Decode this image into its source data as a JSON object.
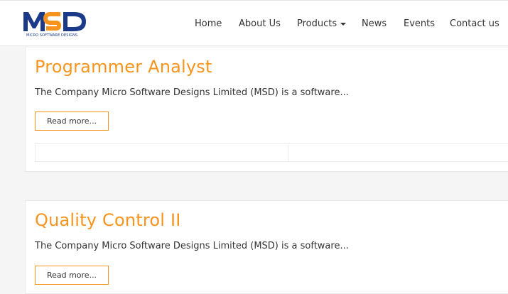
{
  "brand": {
    "logo_text": "MSD",
    "logo_subtitle": "MICRO SOFTWARE DESIGNS",
    "colors": {
      "blue": "#1b3a8a",
      "orange": "#f7941d"
    }
  },
  "nav": {
    "items": [
      {
        "label": "Home"
      },
      {
        "label": "About Us"
      },
      {
        "label": "Products"
      },
      {
        "label": "News"
      },
      {
        "label": "Events"
      },
      {
        "label": "Contact us"
      }
    ]
  },
  "jobs": [
    {
      "title": "Programmer Analyst",
      "description": "The Company Micro Software Designs Limited (MSD) is a software...",
      "button": "Read more..."
    },
    {
      "title": "Quality Control II",
      "description": "The Company Micro Software Designs Limited (MSD) is a software...",
      "button": "Read more..."
    }
  ]
}
